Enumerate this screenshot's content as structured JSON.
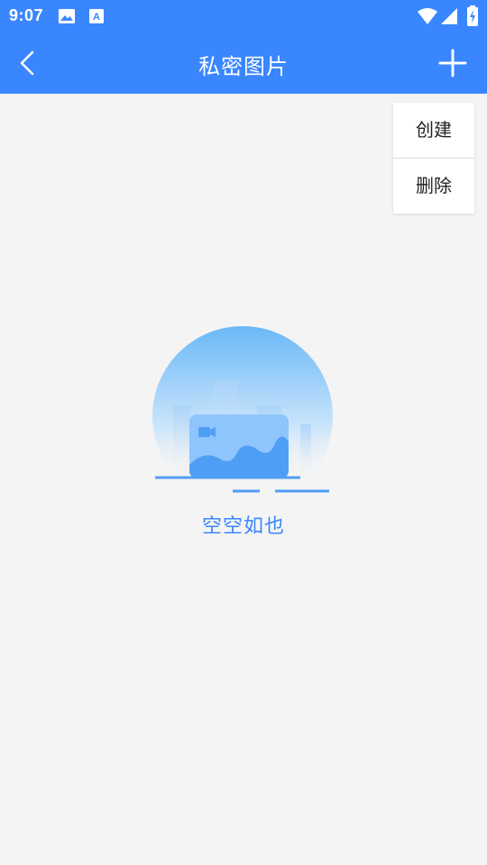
{
  "status_bar": {
    "time": "9:07",
    "left_icons": [
      "image-icon",
      "keyboard-a-icon"
    ],
    "right_icons": [
      "wifi-icon",
      "signal-icon",
      "battery-charging-icon"
    ]
  },
  "app_bar": {
    "title": "私密图片",
    "back_icon": "chevron-left-icon",
    "add_icon": "plus-icon"
  },
  "popup_menu": {
    "items": [
      {
        "label": "创建"
      },
      {
        "label": "删除"
      }
    ]
  },
  "empty_state": {
    "illustration_icon": "empty-gallery-illustration",
    "text": "空空如也"
  },
  "colors": {
    "primary": "#3a86ff",
    "background": "#f4f4f4",
    "menu_background": "#ffffff",
    "empty_text": "#3a86ff"
  }
}
